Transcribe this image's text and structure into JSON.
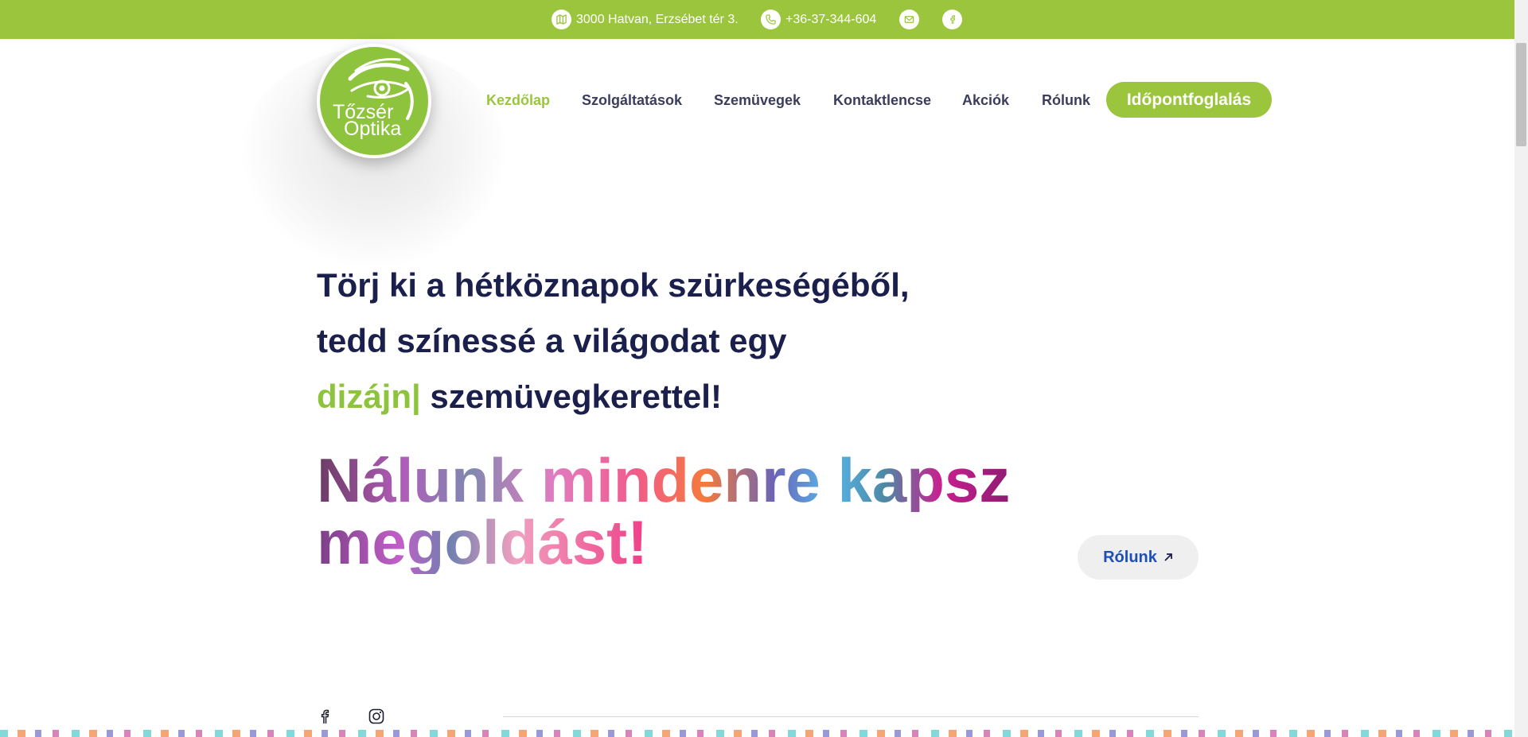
{
  "topbar": {
    "address": "3000 Hatvan, Erzsébet tér 3.",
    "phone": "+36-37-344-604",
    "icons": [
      "map-icon",
      "phone-icon",
      "mail-icon",
      "facebook-icon"
    ]
  },
  "logo": {
    "line1": "Tőzsér",
    "line2": "Optika"
  },
  "nav": {
    "items": [
      "Kezdőlap",
      "Szolgáltatások",
      "Szemüvegek",
      "Kontaktlencse",
      "Akciók",
      "Rólunk"
    ],
    "active": "Kezdőlap",
    "cta": "Időpontfoglalás"
  },
  "hero": {
    "line1": "Törj ki a hétköznapok szürkeségéből,",
    "line2": "tedd színessé a világodat egy",
    "line3_accent": "dizájn|",
    "line3_rest": " szemüvegkerettel!",
    "big1": "Nálunk mindenre kapsz",
    "big2": "megoldást!",
    "about_button": "Rólunk"
  },
  "social": [
    "facebook-icon",
    "instagram-icon"
  ],
  "colors": {
    "brand_green": "#9bc53d",
    "navy": "#1b1f4b",
    "link_blue": "#1e4fb5"
  }
}
